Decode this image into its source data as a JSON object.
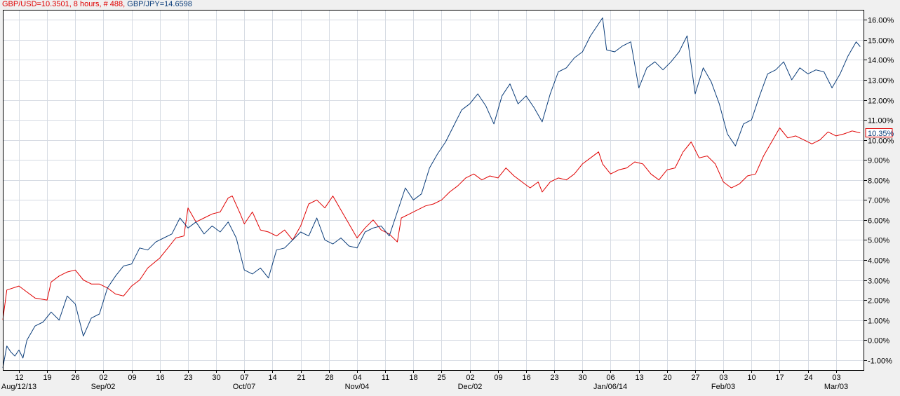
{
  "legend": {
    "usd_text": "GBP/USD=10.3501, 8 hours, # 488,",
    "jpy_text": "GBP/JPY=14.6598"
  },
  "last_value_label": "10.35%",
  "colors": {
    "gbpusd": "#e00000",
    "gbpjpy": "#0b3d7a",
    "grid": "#d6dbe3",
    "plot_bg": "#ffffff",
    "page_bg": "#f0f0f0"
  },
  "chart_data": {
    "type": "line",
    "ylim": [
      -1.5,
      16.5
    ],
    "yticks": [
      "-1.00%",
      "0.00%",
      "1.00%",
      "2.00%",
      "3.00%",
      "4.00%",
      "5.00%",
      "6.00%",
      "7.00%",
      "8.00%",
      "9.00%",
      "10.00%",
      "11.00%",
      "12.00%",
      "13.00%",
      "14.00%",
      "15.00%",
      "16.00%"
    ],
    "ytick_values": [
      -1,
      0,
      1,
      2,
      3,
      4,
      5,
      6,
      7,
      8,
      9,
      10,
      11,
      12,
      13,
      14,
      15,
      16
    ],
    "xlim": [
      "2013-08-08",
      "2014-03-10"
    ],
    "xticks_day": [
      {
        "label": "12",
        "date": "2013-08-12"
      },
      {
        "label": "19",
        "date": "2013-08-19"
      },
      {
        "label": "26",
        "date": "2013-08-26"
      },
      {
        "label": "02",
        "date": "2013-09-02"
      },
      {
        "label": "09",
        "date": "2013-09-09"
      },
      {
        "label": "16",
        "date": "2013-09-16"
      },
      {
        "label": "23",
        "date": "2013-09-23"
      },
      {
        "label": "30",
        "date": "2013-09-30"
      },
      {
        "label": "07",
        "date": "2013-10-07"
      },
      {
        "label": "14",
        "date": "2013-10-14"
      },
      {
        "label": "21",
        "date": "2013-10-21"
      },
      {
        "label": "28",
        "date": "2013-10-28"
      },
      {
        "label": "04",
        "date": "2013-11-04"
      },
      {
        "label": "11",
        "date": "2013-11-11"
      },
      {
        "label": "18",
        "date": "2013-11-18"
      },
      {
        "label": "25",
        "date": "2013-11-25"
      },
      {
        "label": "02",
        "date": "2013-12-02"
      },
      {
        "label": "09",
        "date": "2013-12-09"
      },
      {
        "label": "16",
        "date": "2013-12-16"
      },
      {
        "label": "23",
        "date": "2013-12-23"
      },
      {
        "label": "30",
        "date": "2013-12-30"
      },
      {
        "label": "06",
        "date": "2014-01-06"
      },
      {
        "label": "13",
        "date": "2014-01-13"
      },
      {
        "label": "20",
        "date": "2014-01-20"
      },
      {
        "label": "27",
        "date": "2014-01-27"
      },
      {
        "label": "03",
        "date": "2014-02-03"
      },
      {
        "label": "10",
        "date": "2014-02-10"
      },
      {
        "label": "17",
        "date": "2014-02-17"
      },
      {
        "label": "24",
        "date": "2014-02-24"
      },
      {
        "label": "03",
        "date": "2014-03-03"
      }
    ],
    "xticks_month": [
      {
        "label": "Aug/12/13",
        "date": "2013-08-12"
      },
      {
        "label": "Sep/02",
        "date": "2013-09-02"
      },
      {
        "label": "Oct/07",
        "date": "2013-10-07"
      },
      {
        "label": "Nov/04",
        "date": "2013-11-04"
      },
      {
        "label": "Dec/02",
        "date": "2013-12-02"
      },
      {
        "label": "Jan/06/14",
        "date": "2014-01-06"
      },
      {
        "label": "Feb/03",
        "date": "2014-02-03"
      },
      {
        "label": "Mar/03",
        "date": "2014-03-03"
      }
    ],
    "series": [
      {
        "name": "GBP/USD",
        "color": "#e00000",
        "points": [
          [
            "2013-08-08",
            1.0
          ],
          [
            "2013-08-09",
            2.5
          ],
          [
            "2013-08-12",
            2.7
          ],
          [
            "2013-08-14",
            2.4
          ],
          [
            "2013-08-16",
            2.1
          ],
          [
            "2013-08-19",
            2.0
          ],
          [
            "2013-08-20",
            2.9
          ],
          [
            "2013-08-22",
            3.2
          ],
          [
            "2013-08-24",
            3.4
          ],
          [
            "2013-08-26",
            3.5
          ],
          [
            "2013-08-28",
            3.0
          ],
          [
            "2013-08-30",
            2.8
          ],
          [
            "2013-09-01",
            2.8
          ],
          [
            "2013-09-03",
            2.6
          ],
          [
            "2013-09-05",
            2.3
          ],
          [
            "2013-09-07",
            2.2
          ],
          [
            "2013-09-09",
            2.7
          ],
          [
            "2013-09-11",
            3.0
          ],
          [
            "2013-09-13",
            3.6
          ],
          [
            "2013-09-16",
            4.1
          ],
          [
            "2013-09-18",
            4.6
          ],
          [
            "2013-09-20",
            5.1
          ],
          [
            "2013-09-22",
            5.2
          ],
          [
            "2013-09-23",
            6.6
          ],
          [
            "2013-09-25",
            5.9
          ],
          [
            "2013-09-27",
            6.1
          ],
          [
            "2013-09-29",
            6.3
          ],
          [
            "2013-10-01",
            6.4
          ],
          [
            "2013-10-03",
            7.1
          ],
          [
            "2013-10-04",
            7.2
          ],
          [
            "2013-10-06",
            6.3
          ],
          [
            "2013-10-07",
            5.8
          ],
          [
            "2013-10-09",
            6.4
          ],
          [
            "2013-10-11",
            5.5
          ],
          [
            "2013-10-13",
            5.4
          ],
          [
            "2013-10-15",
            5.2
          ],
          [
            "2013-10-17",
            5.5
          ],
          [
            "2013-10-19",
            5.0
          ],
          [
            "2013-10-21",
            5.7
          ],
          [
            "2013-10-23",
            6.8
          ],
          [
            "2013-10-25",
            7.0
          ],
          [
            "2013-10-27",
            6.6
          ],
          [
            "2013-10-29",
            7.2
          ],
          [
            "2013-10-31",
            6.5
          ],
          [
            "2013-11-02",
            5.8
          ],
          [
            "2013-11-04",
            5.1
          ],
          [
            "2013-11-06",
            5.6
          ],
          [
            "2013-11-08",
            6.0
          ],
          [
            "2013-11-10",
            5.5
          ],
          [
            "2013-11-12",
            5.3
          ],
          [
            "2013-11-14",
            4.9
          ],
          [
            "2013-11-15",
            6.1
          ],
          [
            "2013-11-17",
            6.3
          ],
          [
            "2013-11-19",
            6.5
          ],
          [
            "2013-11-21",
            6.7
          ],
          [
            "2013-11-23",
            6.8
          ],
          [
            "2013-11-25",
            7.0
          ],
          [
            "2013-11-27",
            7.4
          ],
          [
            "2013-11-29",
            7.7
          ],
          [
            "2013-12-01",
            8.1
          ],
          [
            "2013-12-03",
            8.3
          ],
          [
            "2013-12-05",
            8.0
          ],
          [
            "2013-12-07",
            8.2
          ],
          [
            "2013-12-09",
            8.1
          ],
          [
            "2013-12-11",
            8.6
          ],
          [
            "2013-12-13",
            8.2
          ],
          [
            "2013-12-15",
            7.9
          ],
          [
            "2013-12-17",
            7.6
          ],
          [
            "2013-12-19",
            7.9
          ],
          [
            "2013-12-20",
            7.4
          ],
          [
            "2013-12-22",
            7.9
          ],
          [
            "2013-12-24",
            8.1
          ],
          [
            "2013-12-26",
            8.0
          ],
          [
            "2013-12-28",
            8.3
          ],
          [
            "2013-12-30",
            8.8
          ],
          [
            "2014-01-01",
            9.1
          ],
          [
            "2014-01-03",
            9.4
          ],
          [
            "2014-01-04",
            8.8
          ],
          [
            "2014-01-06",
            8.3
          ],
          [
            "2014-01-08",
            8.5
          ],
          [
            "2014-01-10",
            8.6
          ],
          [
            "2014-01-12",
            8.9
          ],
          [
            "2014-01-14",
            8.8
          ],
          [
            "2014-01-16",
            8.3
          ],
          [
            "2014-01-18",
            8.0
          ],
          [
            "2014-01-20",
            8.5
          ],
          [
            "2014-01-22",
            8.6
          ],
          [
            "2014-01-24",
            9.4
          ],
          [
            "2014-01-26",
            9.9
          ],
          [
            "2014-01-28",
            9.1
          ],
          [
            "2014-01-30",
            9.2
          ],
          [
            "2014-02-01",
            8.8
          ],
          [
            "2014-02-03",
            7.9
          ],
          [
            "2014-02-05",
            7.6
          ],
          [
            "2014-02-07",
            7.8
          ],
          [
            "2014-02-09",
            8.2
          ],
          [
            "2014-02-11",
            8.3
          ],
          [
            "2014-02-13",
            9.2
          ],
          [
            "2014-02-15",
            9.9
          ],
          [
            "2014-02-17",
            10.6
          ],
          [
            "2014-02-19",
            10.1
          ],
          [
            "2014-02-21",
            10.2
          ],
          [
            "2014-02-23",
            10.0
          ],
          [
            "2014-02-25",
            9.8
          ],
          [
            "2014-02-27",
            10.0
          ],
          [
            "2014-03-01",
            10.4
          ],
          [
            "2014-03-03",
            10.2
          ],
          [
            "2014-03-05",
            10.3
          ],
          [
            "2014-03-07",
            10.45
          ],
          [
            "2014-03-09",
            10.35
          ]
        ]
      },
      {
        "name": "GBP/JPY",
        "color": "#0b3d7a",
        "points": [
          [
            "2013-08-08",
            -1.4
          ],
          [
            "2013-08-09",
            -0.3
          ],
          [
            "2013-08-10",
            -0.6
          ],
          [
            "2013-08-11",
            -0.8
          ],
          [
            "2013-08-12",
            -0.5
          ],
          [
            "2013-08-13",
            -0.9
          ],
          [
            "2013-08-14",
            0.0
          ],
          [
            "2013-08-16",
            0.7
          ],
          [
            "2013-08-18",
            0.9
          ],
          [
            "2013-08-20",
            1.4
          ],
          [
            "2013-08-22",
            1.0
          ],
          [
            "2013-08-24",
            2.2
          ],
          [
            "2013-08-26",
            1.8
          ],
          [
            "2013-08-28",
            0.2
          ],
          [
            "2013-08-30",
            1.1
          ],
          [
            "2013-09-01",
            1.3
          ],
          [
            "2013-09-03",
            2.6
          ],
          [
            "2013-09-05",
            3.2
          ],
          [
            "2013-09-07",
            3.7
          ],
          [
            "2013-09-09",
            3.8
          ],
          [
            "2013-09-11",
            4.6
          ],
          [
            "2013-09-13",
            4.5
          ],
          [
            "2013-09-15",
            4.9
          ],
          [
            "2013-09-17",
            5.1
          ],
          [
            "2013-09-19",
            5.3
          ],
          [
            "2013-09-21",
            6.1
          ],
          [
            "2013-09-23",
            5.6
          ],
          [
            "2013-09-25",
            5.9
          ],
          [
            "2013-09-27",
            5.3
          ],
          [
            "2013-09-29",
            5.7
          ],
          [
            "2013-10-01",
            5.4
          ],
          [
            "2013-10-03",
            5.9
          ],
          [
            "2013-10-05",
            5.1
          ],
          [
            "2013-10-07",
            3.5
          ],
          [
            "2013-10-09",
            3.3
          ],
          [
            "2013-10-11",
            3.6
          ],
          [
            "2013-10-13",
            3.1
          ],
          [
            "2013-10-15",
            4.5
          ],
          [
            "2013-10-17",
            4.6
          ],
          [
            "2013-10-19",
            5.0
          ],
          [
            "2013-10-21",
            5.4
          ],
          [
            "2013-10-23",
            5.2
          ],
          [
            "2013-10-25",
            6.1
          ],
          [
            "2013-10-27",
            5.0
          ],
          [
            "2013-10-29",
            4.8
          ],
          [
            "2013-10-31",
            5.1
          ],
          [
            "2013-11-02",
            4.7
          ],
          [
            "2013-11-04",
            4.6
          ],
          [
            "2013-11-06",
            5.4
          ],
          [
            "2013-11-08",
            5.6
          ],
          [
            "2013-11-10",
            5.7
          ],
          [
            "2013-11-12",
            5.2
          ],
          [
            "2013-11-14",
            6.4
          ],
          [
            "2013-11-16",
            7.6
          ],
          [
            "2013-11-18",
            7.0
          ],
          [
            "2013-11-20",
            7.3
          ],
          [
            "2013-11-22",
            8.6
          ],
          [
            "2013-11-24",
            9.3
          ],
          [
            "2013-11-26",
            9.9
          ],
          [
            "2013-11-28",
            10.7
          ],
          [
            "2013-11-30",
            11.5
          ],
          [
            "2013-12-02",
            11.8
          ],
          [
            "2013-12-04",
            12.3
          ],
          [
            "2013-12-06",
            11.7
          ],
          [
            "2013-12-08",
            10.8
          ],
          [
            "2013-12-10",
            12.2
          ],
          [
            "2013-12-12",
            12.8
          ],
          [
            "2013-12-14",
            11.8
          ],
          [
            "2013-12-16",
            12.2
          ],
          [
            "2013-12-18",
            11.6
          ],
          [
            "2013-12-20",
            10.9
          ],
          [
            "2013-12-22",
            12.3
          ],
          [
            "2013-12-24",
            13.4
          ],
          [
            "2013-12-26",
            13.6
          ],
          [
            "2013-12-28",
            14.1
          ],
          [
            "2013-12-30",
            14.4
          ],
          [
            "2014-01-01",
            15.2
          ],
          [
            "2014-01-03",
            15.8
          ],
          [
            "2014-01-04",
            16.1
          ],
          [
            "2014-01-05",
            14.5
          ],
          [
            "2014-01-07",
            14.4
          ],
          [
            "2014-01-09",
            14.7
          ],
          [
            "2014-01-11",
            14.9
          ],
          [
            "2014-01-13",
            12.6
          ],
          [
            "2014-01-15",
            13.6
          ],
          [
            "2014-01-17",
            13.9
          ],
          [
            "2014-01-19",
            13.5
          ],
          [
            "2014-01-21",
            13.9
          ],
          [
            "2014-01-23",
            14.4
          ],
          [
            "2014-01-25",
            15.2
          ],
          [
            "2014-01-27",
            12.3
          ],
          [
            "2014-01-29",
            13.6
          ],
          [
            "2014-01-31",
            12.9
          ],
          [
            "2014-02-02",
            11.8
          ],
          [
            "2014-02-04",
            10.3
          ],
          [
            "2014-02-06",
            9.7
          ],
          [
            "2014-02-08",
            10.8
          ],
          [
            "2014-02-10",
            11.0
          ],
          [
            "2014-02-12",
            12.2
          ],
          [
            "2014-02-14",
            13.3
          ],
          [
            "2014-02-16",
            13.5
          ],
          [
            "2014-02-18",
            13.9
          ],
          [
            "2014-02-20",
            13.0
          ],
          [
            "2014-02-22",
            13.6
          ],
          [
            "2014-02-24",
            13.3
          ],
          [
            "2014-02-26",
            13.5
          ],
          [
            "2014-02-28",
            13.4
          ],
          [
            "2014-03-02",
            12.6
          ],
          [
            "2014-03-04",
            13.3
          ],
          [
            "2014-03-06",
            14.2
          ],
          [
            "2014-03-08",
            14.9
          ],
          [
            "2014-03-09",
            14.66
          ]
        ]
      }
    ]
  }
}
